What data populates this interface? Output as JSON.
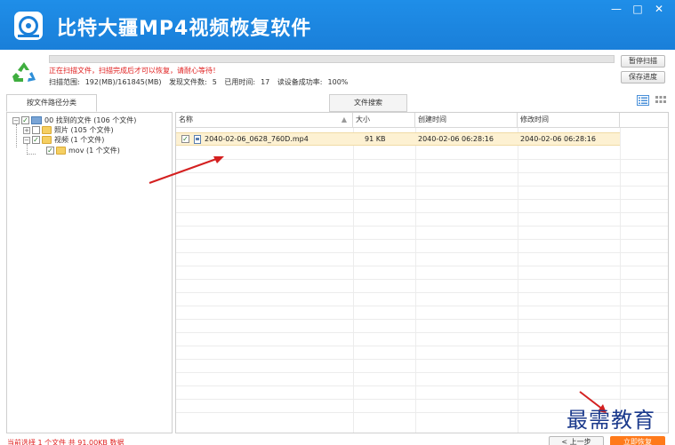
{
  "window": {
    "title": "比特大疆MP4视频恢复软件",
    "minimize": "—",
    "maximize": "□",
    "close": "✕"
  },
  "scan": {
    "status": "正在扫描文件，扫描完成后才可以恢复，请耐心等待！",
    "range_label": "扫描范围:",
    "range_value": "192(MB)/161845(MB)",
    "found_label": "发现文件数:",
    "found_value": "5",
    "elapsed_label": "已用时间:",
    "elapsed_value": "17",
    "success_label": "读设备成功率:",
    "success_value": "100%",
    "pause_button": "暂停扫描",
    "save_button": "保存进度"
  },
  "tabs": {
    "path_tab": "按文件路径分类",
    "search_tab": "文件搜索"
  },
  "tree": {
    "root": "00 找到的文件  (106 个文件)",
    "photos": "照片    (105 个文件)",
    "videos": "视频    (1 个文件)",
    "mov": "mov    (1 个文件)"
  },
  "table": {
    "columns": {
      "name": "名称",
      "size": "大小",
      "created": "创建时间",
      "modified": "修改时间"
    },
    "rows": [
      {
        "name": "2040-02-06_0628_760D.mp4",
        "size": "91 KB",
        "created": "2040-02-06  06:28:16",
        "modified": "2040-02-06  06:28:16"
      }
    ]
  },
  "bottom": {
    "status": "当前选择 1 个文件 共 91.00KB 数据",
    "prev_button": "< 上一步",
    "recover_button": "立即恢复"
  },
  "watermark": "最需教育",
  "colors": {
    "titlebar": "#1a7fd9",
    "accent_orange": "#ff7a1a",
    "status_red": "#e02020",
    "selected_row": "#fdf1d2"
  }
}
